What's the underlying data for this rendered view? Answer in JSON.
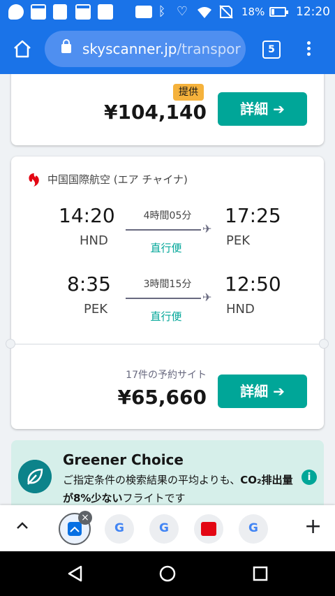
{
  "status_bar": {
    "battery_pct": "18%",
    "time": "12:20",
    "icons": [
      "chat-icon",
      "calendar-icon",
      "contacts-icon",
      "calendar-icon",
      "alert-icon",
      "voicemail-icon",
      "bluetooth-icon",
      "wifi-icon",
      "no-sim-icon",
      "battery-icon"
    ]
  },
  "browser": {
    "url_domain": "skyscanner.jp",
    "url_path": "/transpor",
    "tab_count": "5"
  },
  "offer_top": {
    "badge": "提供",
    "price": "¥104,140",
    "button": "詳細 ➔"
  },
  "flight_card": {
    "airline": "中国国際航空 (エア チャイナ)",
    "legs": [
      {
        "depart_time": "14:20",
        "depart_code": "HND",
        "duration": "4時間05分",
        "stops": "直行便",
        "arrive_time": "17:25",
        "arrive_code": "PEK"
      },
      {
        "depart_time": "8:35",
        "depart_code": "PEK",
        "duration": "3時間15分",
        "stops": "直行便",
        "arrive_time": "12:50",
        "arrive_code": "HND"
      }
    ],
    "sites": "17件の予約サイト",
    "price": "¥65,660",
    "button": "詳細 ➔"
  },
  "greener": {
    "title": "Greener Choice",
    "text_1": "ご指定条件の検索結果の平均よりも、",
    "text_2": "CO₂排出量が8%少ない",
    "text_3": "フライトです",
    "info": "i"
  },
  "tab_strip": {
    "close": "×",
    "plus": "+",
    "tabs": [
      "skyscanner",
      "google",
      "google",
      "airline",
      "google"
    ]
  },
  "colors": {
    "chrome_blue": "#1a73e8",
    "teal": "#00a698",
    "badge_yellow": "#f5b23c",
    "green_bg": "#d6efea",
    "airchina_red": "#e30613"
  }
}
